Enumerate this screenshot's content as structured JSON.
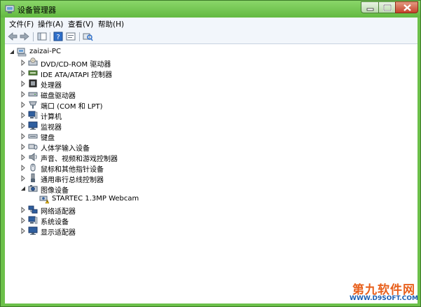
{
  "window": {
    "title": "设备管理器"
  },
  "menu": [
    {
      "label": "文件(F)"
    },
    {
      "label": "操作(A)"
    },
    {
      "label": "查看(V)"
    },
    {
      "label": "帮助(H)"
    }
  ],
  "toolbar": {
    "icons": [
      "back-arrow-icon",
      "forward-arrow-icon",
      "show-hide-tree-icon",
      "help-icon",
      "properties-icon",
      "scan-hardware-icon"
    ]
  },
  "tree": {
    "root": {
      "label": "zaizai-PC",
      "expanded": true
    },
    "items": [
      {
        "label": "DVD/CD-ROM 驱动器",
        "icon": "dvd-drive-icon",
        "expanded": false
      },
      {
        "label": "IDE ATA/ATAPI 控制器",
        "icon": "ide-controller-icon",
        "expanded": false
      },
      {
        "label": "处理器",
        "icon": "processor-icon",
        "expanded": false
      },
      {
        "label": "磁盘驱动器",
        "icon": "disk-drive-icon",
        "expanded": false
      },
      {
        "label": "端口 (COM 和 LPT)",
        "icon": "port-icon",
        "expanded": false
      },
      {
        "label": "计算机",
        "icon": "computer-icon",
        "expanded": false
      },
      {
        "label": "监视器",
        "icon": "monitor-icon",
        "expanded": false
      },
      {
        "label": "键盘",
        "icon": "keyboard-icon",
        "expanded": false
      },
      {
        "label": "人体学输入设备",
        "icon": "hid-icon",
        "expanded": false
      },
      {
        "label": "声音、视频和游戏控制器",
        "icon": "sound-icon",
        "expanded": false
      },
      {
        "label": "鼠标和其他指针设备",
        "icon": "mouse-icon",
        "expanded": false
      },
      {
        "label": "通用串行总线控制器",
        "icon": "usb-icon",
        "expanded": false
      },
      {
        "label": "图像设备",
        "icon": "imaging-device-icon",
        "expanded": true,
        "children": [
          {
            "label": "STARTEC 1.3MP Webcam",
            "icon": "webcam-warning-icon"
          }
        ]
      },
      {
        "label": "网络适配器",
        "icon": "network-adapter-icon",
        "expanded": false
      },
      {
        "label": "系统设备",
        "icon": "system-device-icon",
        "expanded": false
      },
      {
        "label": "显示适配器",
        "icon": "display-adapter-icon",
        "expanded": false
      }
    ]
  },
  "watermark": {
    "main": "第九软件网",
    "url": "WWW.D9SOFT.COM"
  },
  "colors": {
    "frame": "#6cc04a",
    "menubar": "#f2f6fb",
    "close_button": "#c5422b",
    "watermark_orange": "#e8601c",
    "watermark_blue": "#1b5fb3"
  }
}
